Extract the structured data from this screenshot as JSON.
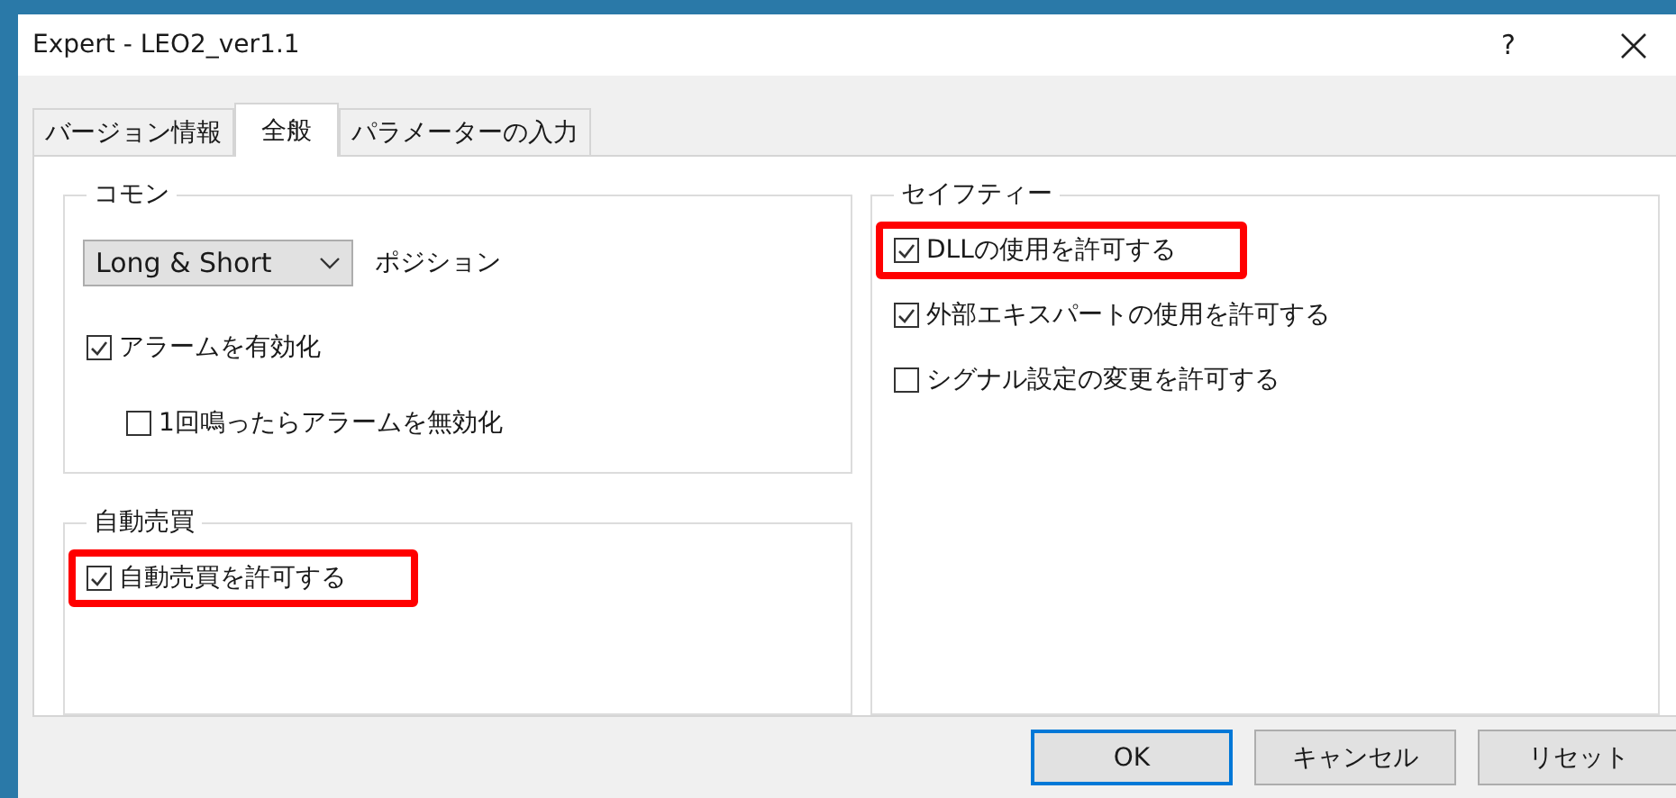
{
  "window": {
    "title": "Expert - LEO2_ver1.1",
    "help": "?"
  },
  "tabs": [
    {
      "label": "バージョン情報",
      "selected": false
    },
    {
      "label": "全般",
      "selected": true
    },
    {
      "label": "パラメーターの入力",
      "selected": false
    }
  ],
  "common": {
    "title": "コモン",
    "dropdown": {
      "value": "Long & Short",
      "label": "ポジション"
    },
    "options": [
      {
        "label": "アラームを有効化",
        "checked": true,
        "highlighted": false,
        "children": [
          {
            "label": "1回鳴ったらアラームを無効化",
            "checked": false,
            "highlighted": false
          }
        ]
      }
    ]
  },
  "auto_trade": {
    "title": "自動売買",
    "options": [
      {
        "label": "自動売買を許可する",
        "checked": true,
        "highlighted": true
      }
    ]
  },
  "safety": {
    "title": "セイフティー",
    "options": [
      {
        "label": "DLLの使用を許可する",
        "checked": true,
        "highlighted": true
      },
      {
        "label": "外部エキスパートの使用を許可する",
        "checked": true,
        "highlighted": false
      },
      {
        "label": "シグナル設定の変更を許可する",
        "checked": false,
        "highlighted": false
      }
    ]
  },
  "buttons": [
    {
      "label": "OK",
      "default": true
    },
    {
      "label": "キャンセル",
      "default": false
    },
    {
      "label": "リセット",
      "default": false
    }
  ]
}
